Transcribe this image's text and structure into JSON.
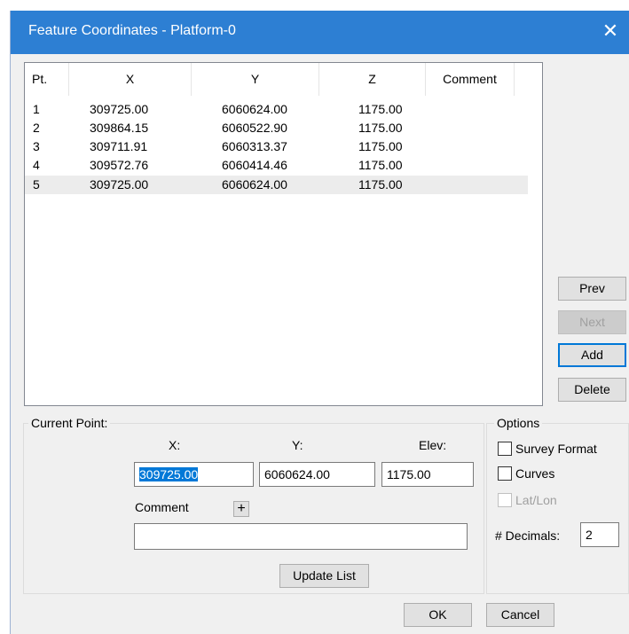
{
  "window": {
    "title": "Feature Coordinates - Platform-0",
    "close_glyph": "✕"
  },
  "table": {
    "headers": [
      "Pt.",
      "X",
      "Y",
      "Z",
      "Comment"
    ],
    "rows": [
      [
        "1",
        "309725.00",
        "6060624.00",
        "1175.00",
        ""
      ],
      [
        "2",
        "309864.15",
        "6060522.90",
        "1175.00",
        ""
      ],
      [
        "3",
        "309711.91",
        "6060313.37",
        "1175.00",
        ""
      ],
      [
        "4",
        "309572.76",
        "6060414.46",
        "1175.00",
        ""
      ],
      [
        "5",
        "309725.00",
        "6060624.00",
        "1175.00",
        ""
      ]
    ],
    "selected_row": 4
  },
  "side_buttons": {
    "prev": "Prev",
    "next": "Next",
    "add": "Add",
    "delete": "Delete"
  },
  "current_point": {
    "group_label": "Current Point:",
    "x_label": "X:",
    "y_label": "Y:",
    "elev_label": "Elev:",
    "x_value": "309725.00",
    "y_value": "6060624.00",
    "elev_value": "1175.00",
    "comment_label": "Comment",
    "comment_add_glyph": "+",
    "comment_value": "",
    "update_button": "Update List"
  },
  "options": {
    "group_label": "Options",
    "survey_format": "Survey Format",
    "curves": "Curves",
    "lat_lon": "Lat/Lon",
    "decimals_label": "# Decimals:",
    "decimals_value": "2"
  },
  "footer": {
    "ok": "OK",
    "cancel": "Cancel"
  }
}
